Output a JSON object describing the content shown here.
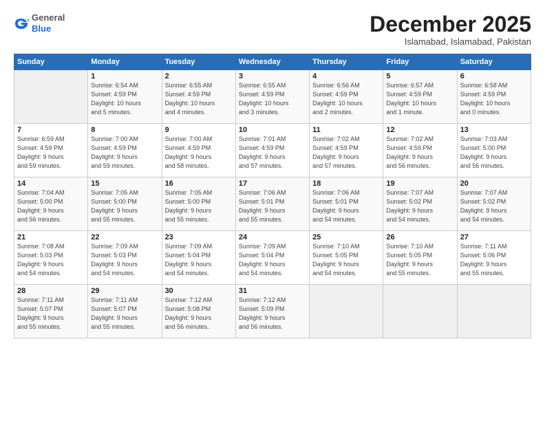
{
  "header": {
    "logo_general": "General",
    "logo_blue": "Blue",
    "month_title": "December 2025",
    "subtitle": "Islamabad, Islamabad, Pakistan"
  },
  "days_of_week": [
    "Sunday",
    "Monday",
    "Tuesday",
    "Wednesday",
    "Thursday",
    "Friday",
    "Saturday"
  ],
  "weeks": [
    [
      {
        "day": "",
        "info": ""
      },
      {
        "day": "1",
        "info": "Sunrise: 6:54 AM\nSunset: 4:59 PM\nDaylight: 10 hours\nand 5 minutes."
      },
      {
        "day": "2",
        "info": "Sunrise: 6:55 AM\nSunset: 4:59 PM\nDaylight: 10 hours\nand 4 minutes."
      },
      {
        "day": "3",
        "info": "Sunrise: 6:55 AM\nSunset: 4:59 PM\nDaylight: 10 hours\nand 3 minutes."
      },
      {
        "day": "4",
        "info": "Sunrise: 6:56 AM\nSunset: 4:59 PM\nDaylight: 10 hours\nand 2 minutes."
      },
      {
        "day": "5",
        "info": "Sunrise: 6:57 AM\nSunset: 4:59 PM\nDaylight: 10 hours\nand 1 minute."
      },
      {
        "day": "6",
        "info": "Sunrise: 6:58 AM\nSunset: 4:59 PM\nDaylight: 10 hours\nand 0 minutes."
      }
    ],
    [
      {
        "day": "7",
        "info": "Sunrise: 6:59 AM\nSunset: 4:59 PM\nDaylight: 9 hours\nand 59 minutes."
      },
      {
        "day": "8",
        "info": "Sunrise: 7:00 AM\nSunset: 4:59 PM\nDaylight: 9 hours\nand 59 minutes."
      },
      {
        "day": "9",
        "info": "Sunrise: 7:00 AM\nSunset: 4:59 PM\nDaylight: 9 hours\nand 58 minutes."
      },
      {
        "day": "10",
        "info": "Sunrise: 7:01 AM\nSunset: 4:59 PM\nDaylight: 9 hours\nand 57 minutes."
      },
      {
        "day": "11",
        "info": "Sunrise: 7:02 AM\nSunset: 4:59 PM\nDaylight: 9 hours\nand 57 minutes."
      },
      {
        "day": "12",
        "info": "Sunrise: 7:02 AM\nSunset: 4:59 PM\nDaylight: 9 hours\nand 56 minutes."
      },
      {
        "day": "13",
        "info": "Sunrise: 7:03 AM\nSunset: 5:00 PM\nDaylight: 9 hours\nand 56 minutes."
      }
    ],
    [
      {
        "day": "14",
        "info": "Sunrise: 7:04 AM\nSunset: 5:00 PM\nDaylight: 9 hours\nand 56 minutes."
      },
      {
        "day": "15",
        "info": "Sunrise: 7:05 AM\nSunset: 5:00 PM\nDaylight: 9 hours\nand 55 minutes."
      },
      {
        "day": "16",
        "info": "Sunrise: 7:05 AM\nSunset: 5:00 PM\nDaylight: 9 hours\nand 55 minutes."
      },
      {
        "day": "17",
        "info": "Sunrise: 7:06 AM\nSunset: 5:01 PM\nDaylight: 9 hours\nand 55 minutes."
      },
      {
        "day": "18",
        "info": "Sunrise: 7:06 AM\nSunset: 5:01 PM\nDaylight: 9 hours\nand 54 minutes."
      },
      {
        "day": "19",
        "info": "Sunrise: 7:07 AM\nSunset: 5:02 PM\nDaylight: 9 hours\nand 54 minutes."
      },
      {
        "day": "20",
        "info": "Sunrise: 7:07 AM\nSunset: 5:02 PM\nDaylight: 9 hours\nand 54 minutes."
      }
    ],
    [
      {
        "day": "21",
        "info": "Sunrise: 7:08 AM\nSunset: 5:03 PM\nDaylight: 9 hours\nand 54 minutes."
      },
      {
        "day": "22",
        "info": "Sunrise: 7:09 AM\nSunset: 5:03 PM\nDaylight: 9 hours\nand 54 minutes."
      },
      {
        "day": "23",
        "info": "Sunrise: 7:09 AM\nSunset: 5:04 PM\nDaylight: 9 hours\nand 54 minutes."
      },
      {
        "day": "24",
        "info": "Sunrise: 7:09 AM\nSunset: 5:04 PM\nDaylight: 9 hours\nand 54 minutes."
      },
      {
        "day": "25",
        "info": "Sunrise: 7:10 AM\nSunset: 5:05 PM\nDaylight: 9 hours\nand 54 minutes."
      },
      {
        "day": "26",
        "info": "Sunrise: 7:10 AM\nSunset: 5:05 PM\nDaylight: 9 hours\nand 55 minutes."
      },
      {
        "day": "27",
        "info": "Sunrise: 7:11 AM\nSunset: 5:06 PM\nDaylight: 9 hours\nand 55 minutes."
      }
    ],
    [
      {
        "day": "28",
        "info": "Sunrise: 7:11 AM\nSunset: 5:07 PM\nDaylight: 9 hours\nand 55 minutes."
      },
      {
        "day": "29",
        "info": "Sunrise: 7:11 AM\nSunset: 5:07 PM\nDaylight: 9 hours\nand 55 minutes."
      },
      {
        "day": "30",
        "info": "Sunrise: 7:12 AM\nSunset: 5:08 PM\nDaylight: 9 hours\nand 56 minutes."
      },
      {
        "day": "31",
        "info": "Sunrise: 7:12 AM\nSunset: 5:09 PM\nDaylight: 9 hours\nand 56 minutes."
      },
      {
        "day": "",
        "info": ""
      },
      {
        "day": "",
        "info": ""
      },
      {
        "day": "",
        "info": ""
      }
    ]
  ]
}
